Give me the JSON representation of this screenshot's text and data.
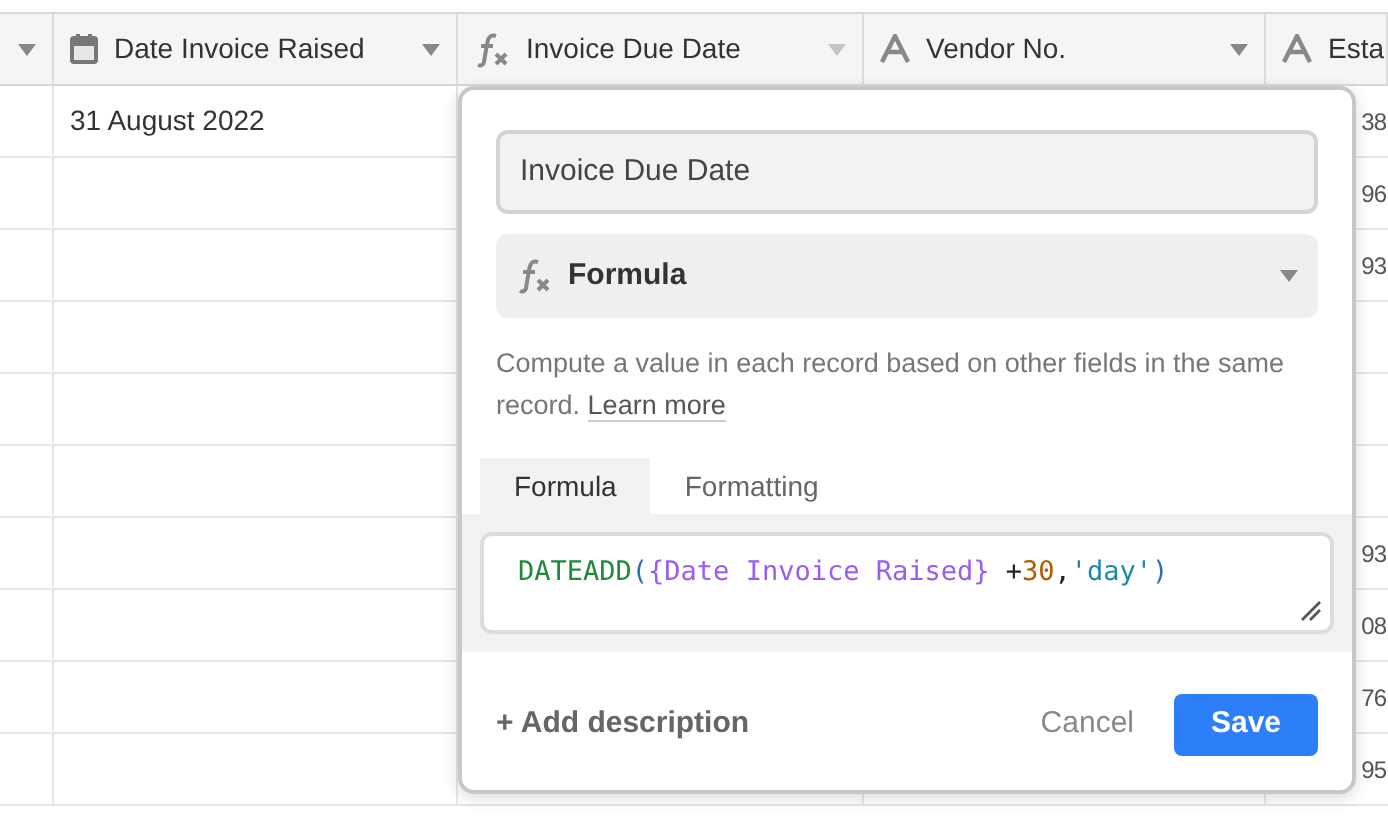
{
  "columns": [
    {
      "kind": "blank"
    },
    {
      "kind": "date",
      "label": "Date Invoice Raised"
    },
    {
      "kind": "formula",
      "label": "Invoice Due Date"
    },
    {
      "kind": "text",
      "label": "Vendor No."
    },
    {
      "kind": "text",
      "label": "Esta"
    }
  ],
  "rows": [
    {
      "date_invoice_raised": "31 August 2022",
      "column_5": "38"
    },
    {
      "column_5": "96"
    },
    {
      "column_5": "93"
    },
    {},
    {},
    {},
    {
      "column_5": "93"
    },
    {
      "column_5": "08"
    },
    {
      "column_5": "76"
    },
    {
      "column_5": "95"
    }
  ],
  "field_editor": {
    "name": "Invoice Due Date",
    "type": "Formula",
    "description": "Compute a value in each record based on other fields in the same record.",
    "learn_more": "Learn more",
    "tabs": [
      {
        "label": "Formula",
        "selected": true
      },
      {
        "label": "Formatting",
        "selected": false
      }
    ],
    "formula": [
      {
        "kind": "function",
        "text": "DATEADD"
      },
      {
        "kind": "paren",
        "text": "("
      },
      {
        "kind": "field",
        "text": "{Date Invoice Raised}"
      },
      {
        "kind": "operator",
        "text": " +"
      },
      {
        "kind": "number",
        "text": "30"
      },
      {
        "kind": "punct",
        "text": ","
      },
      {
        "kind": "string",
        "text": "'day'"
      },
      {
        "kind": "paren",
        "text": ")"
      }
    ],
    "add_description": "+ Add description",
    "cancel": "Cancel",
    "save": "Save"
  }
}
